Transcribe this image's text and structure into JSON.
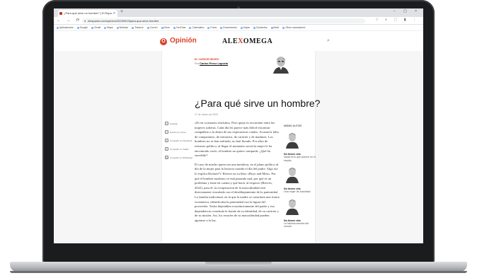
{
  "browser": {
    "tab_title": "¿Para qué sirve un hombre? | El Espa...",
    "tab_close": "×",
    "tab_new": "+",
    "window_controls": "– ▢ ×",
    "nav_buttons": "← → ⟳ ⌂",
    "url": "elespanol.com/opinion/20230313/para-que-sirve-hombre",
    "ext_icons": "☆ ◐ ⬚ ▮ ⋮",
    "bookmarks": [
      "Aplicaciones",
      "Google",
      "Gmail",
      "Maps",
      "Noticias",
      "Traducir",
      "Correo",
      "Drive",
      "YouTube",
      "Calendario",
      "Fotos",
      "Documentos",
      "Hojas",
      "Contactos",
      "Meet",
      "Otros marcadores"
    ]
  },
  "site": {
    "section_icon": "O",
    "section_label": "Opinión",
    "logo_left": "ALE",
    "logo_x": "X",
    "logo_right": "OMEGA",
    "search_icon": "⌕"
  },
  "article": {
    "kicker": "EL CURSOR NEGRO",
    "byline_prefix": "Por",
    "author": "Carlos Pérez Laporta",
    "headline": "¿Para qué sirve un hombre?",
    "date": "17 de marzo de 2023",
    "paragraphs": [
      "«Es en ocasiones tristísimo. Pero queja es recurrente entre las mujeres solteras. Cada día les parece más difícil encontrar compañero a la altura de sus expectativas vitales. Acusan la falta de compromiso, de iniciativa, de carácter y de madurez. Los hombres no se han enfriado, no han llorado. Por años de esfuerzo político, al llegar el momento social la mujer le ha encontrado vacío, el hombre no quiere compartir. ¿Qué ha sucedido?",
      "El caso de mucho quien sea una metáfora, en el plano político al día de la mujer para la historia cuando el día del padre. Algo así lo explica Richard V. Reeves en su libro «Boys and Men». Por qué el hombre moderno se está pasando mal, por qué es un problema y tiene en cuenta y qué hacer al respecto (Reeves, 2022): para él, la recuperación de la masculinidad está directamente vinculada con el desdibujamiento de la paternidad. La familia tradicional, en la que la madre se constituía una forma económica, identificaba la paternidad con la figura del proveedor. Todos dependían económicamente del padre y esa dependencia constituía la fuente de su identidad, de su carácter y de su misión. Así, los resortes de su masculinidad pueden agotarse a la luz."
    ],
    "share_items": [
      {
        "icon": "□",
        "label": "Guardar"
      },
      {
        "icon": "✓",
        "label": "Enviar por correo"
      },
      {
        "icon": "f",
        "label": "Compartir en Facebook"
      },
      {
        "icon": "t",
        "label": "Compartir en Twitter"
      },
      {
        "icon": "◎",
        "label": "Compartir en WhatsApp"
      }
    ]
  },
  "sidebar": {
    "title": "Mismo autor",
    "items": [
      {
        "name": "No tienen vita",
        "desc": "Nada es lo que parece en el espejo"
      },
      {
        "name": "No tienen vita",
        "desc": "Una mujer de autoridad"
      },
      {
        "name": "No tienen vita",
        "desc": "La historia secreta del mundo"
      }
    ]
  }
}
